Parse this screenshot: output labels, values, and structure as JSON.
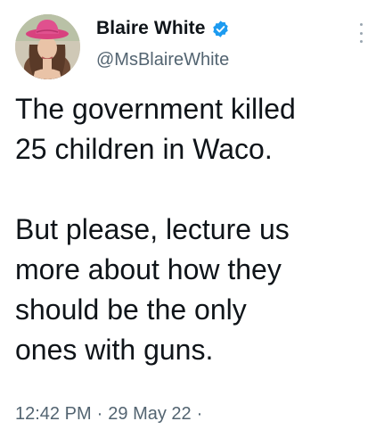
{
  "author": {
    "display_name": "Blaire White",
    "handle": "@MsBlaireWhite",
    "verified": true
  },
  "icons": {
    "verified": "verified-badge-icon",
    "more": "more-options-icon",
    "avatar": "profile-photo"
  },
  "tweet": {
    "paragraph1": [
      "The government killed",
      "25 children in Waco."
    ],
    "paragraph2": [
      "But please, lecture us",
      "more about how they",
      "should be the only",
      "ones with guns."
    ]
  },
  "meta": {
    "time": "12:42 PM",
    "date": "29 May 22",
    "separator": "·"
  },
  "colors": {
    "text": "#0f1419",
    "secondary": "#536471",
    "verified": "#1d9bf0",
    "hat": "#e0508e"
  }
}
